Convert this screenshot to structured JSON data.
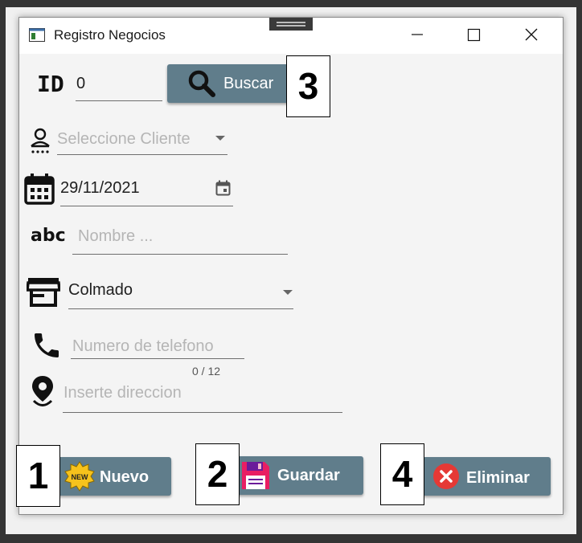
{
  "window": {
    "title": "Registro Negocios"
  },
  "id_field": {
    "label": "ID",
    "value": "0"
  },
  "search_button": {
    "label": "Buscar"
  },
  "client_select": {
    "placeholder": "Seleccione Cliente"
  },
  "date_field": {
    "value": "29/11/2021"
  },
  "name_field": {
    "label": "abc",
    "placeholder": "Nombre ..."
  },
  "type_select": {
    "selected": "Colmado"
  },
  "phone_field": {
    "placeholder": "Numero de telefono",
    "counter": "0 / 12"
  },
  "address_field": {
    "placeholder": "Inserte direccion"
  },
  "actions": {
    "new_label": "Nuevo",
    "new_icon_text": "NEW",
    "save_label": "Guardar",
    "delete_label": "Eliminar"
  },
  "annotations": [
    "1",
    "2",
    "3",
    "4"
  ],
  "colors": {
    "button_bg": "#607d8b",
    "delete_icon": "#e53935",
    "save_icon": "#e91e63"
  }
}
